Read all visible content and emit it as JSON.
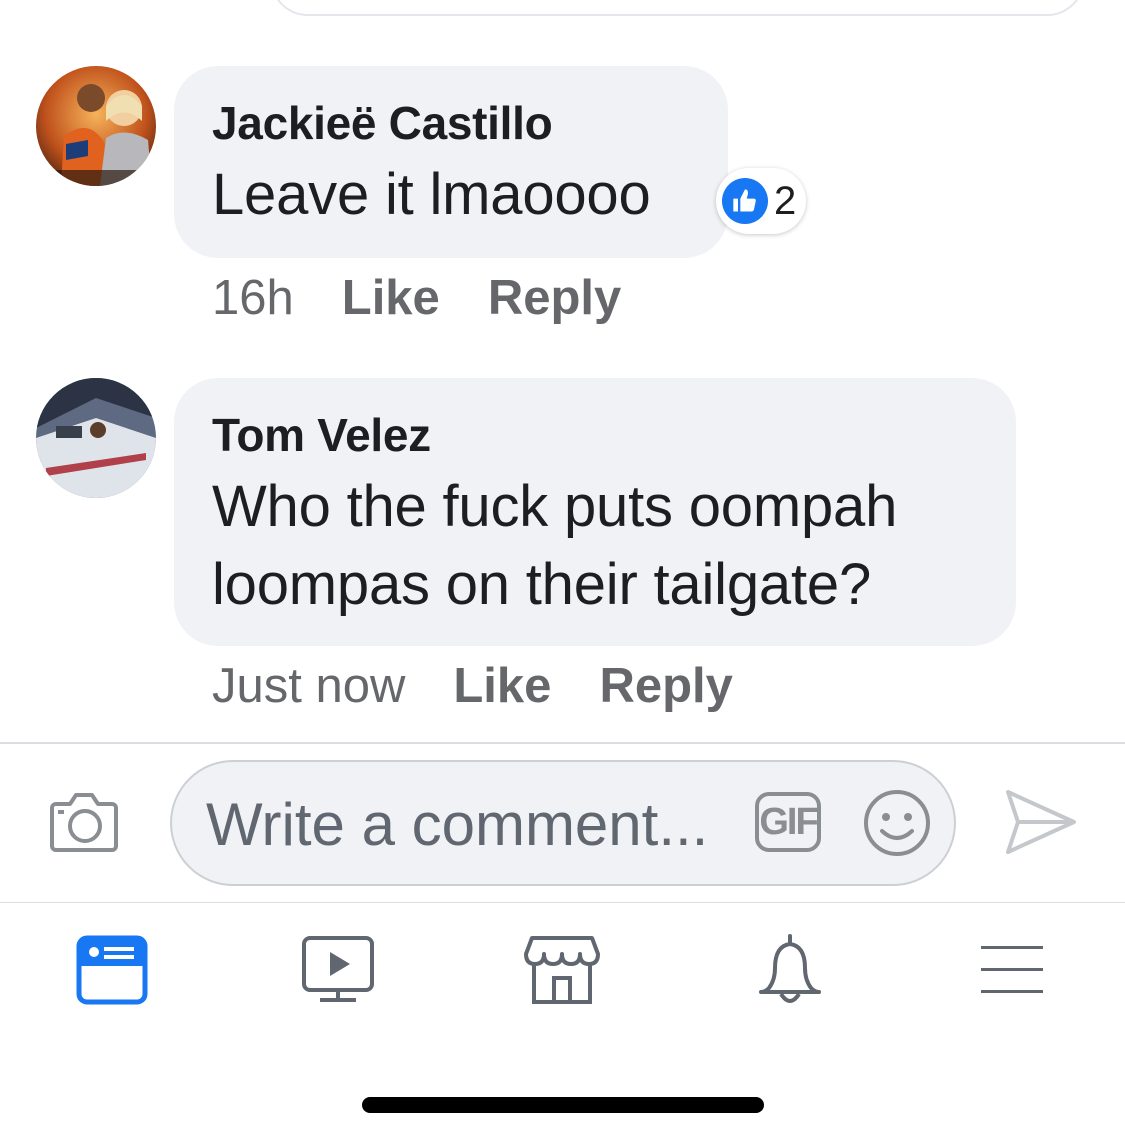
{
  "comments": [
    {
      "author": "Jackieë Castillo",
      "text": [
        "Leave it lmaoooo"
      ],
      "time": "16h",
      "like_label": "Like",
      "reply_label": "Reply",
      "reaction_count": "2"
    },
    {
      "author": "Tom Velez",
      "text": [
        "Who the fuck puts oompah",
        "loompas on their tailgate?"
      ],
      "time": "Just now",
      "like_label": "Like",
      "reply_label": "Reply"
    }
  ],
  "composer": {
    "placeholder": "Write a comment...",
    "gif_label": "GIF"
  },
  "icons": {
    "camera": "camera-icon",
    "gif": "gif-icon",
    "emoji": "emoji-icon",
    "send": "send-icon",
    "like_reaction": "thumbs-up-icon"
  },
  "bottom_nav": [
    {
      "name": "news-feed",
      "icon": "news-feed-icon",
      "active": true
    },
    {
      "name": "watch",
      "icon": "watch-icon",
      "active": false
    },
    {
      "name": "marketplace",
      "icon": "marketplace-icon",
      "active": false
    },
    {
      "name": "notifications",
      "icon": "bell-icon",
      "active": false
    },
    {
      "name": "menu",
      "icon": "menu-icon",
      "active": false
    }
  ],
  "colors": {
    "accent": "#1877f2",
    "bubble": "#f0f2f5",
    "secondary_text": "#65676b",
    "primary_text": "#1c1e21",
    "icon_gray": "#8a8d91"
  }
}
